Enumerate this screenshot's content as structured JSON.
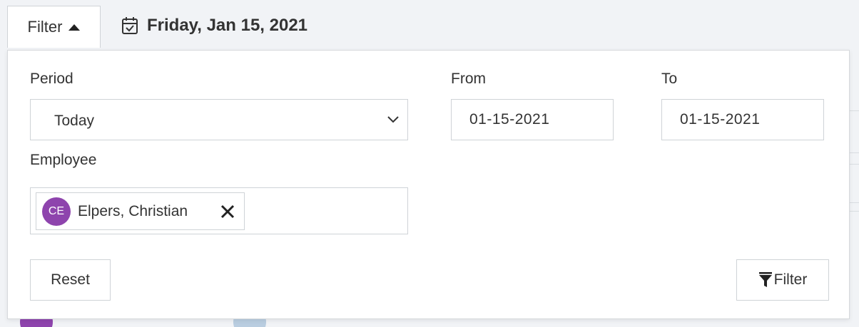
{
  "toolbar": {
    "filter_label": "Filter",
    "date_text": "Friday, Jan 15, 2021"
  },
  "panel": {
    "period": {
      "label": "Period",
      "value": "Today"
    },
    "from": {
      "label": "From",
      "value": "01-15-2021"
    },
    "to": {
      "label": "To",
      "value": "01-15-2021"
    },
    "employee": {
      "label": "Employee",
      "selected": [
        {
          "initials": "CE",
          "name": "Elpers, Christian"
        }
      ]
    },
    "reset_label": "Reset",
    "filter_label": "Filter"
  },
  "colors": {
    "avatar": "#8e44ad",
    "border": "#cfd3d7",
    "background": "#f1f3f6"
  }
}
